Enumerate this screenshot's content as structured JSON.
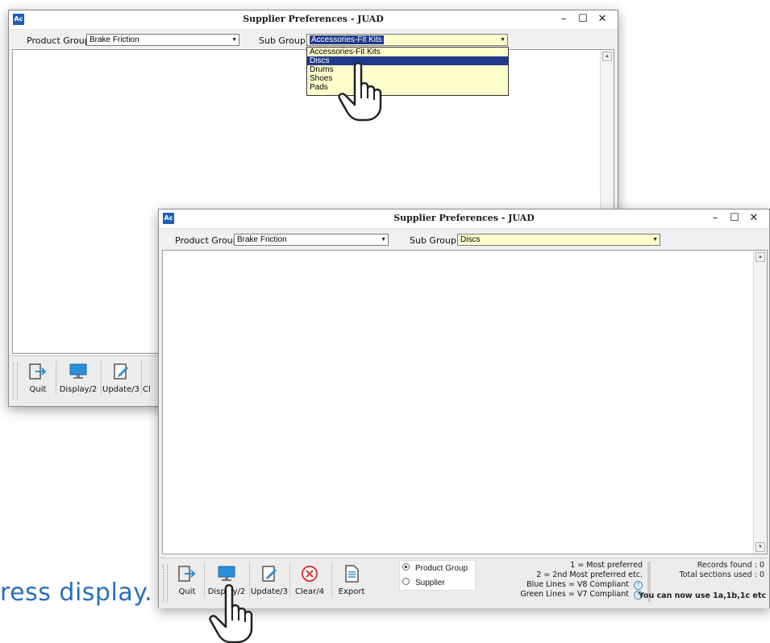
{
  "background_caption": "ress display.",
  "back_window": {
    "icon_label": "Ac",
    "title": "Supplier Preferences - JUAD",
    "product_group_label": "Product Group",
    "product_group_value": "Brake Friction",
    "sub_group_label": "Sub Group",
    "sub_group_value": "Accessories-Fit Kits",
    "dropdown_options": [
      "Accessories-Fit Kits",
      "Discs",
      "Drums",
      "Shoes",
      "Pads"
    ],
    "dropdown_selected": "Discs",
    "toolbar": {
      "quit": "Quit",
      "display": "Display/2",
      "update": "Update/3",
      "clear_partial": "Cl"
    }
  },
  "front_window": {
    "icon_label": "Ac",
    "title": "Supplier Preferences - JUAD",
    "product_group_label": "Product Group",
    "product_group_value": "Brake Friction",
    "sub_group_label": "Sub Group",
    "sub_group_value": "Discs",
    "toolbar": {
      "quit": "Quit",
      "display": "Display/2",
      "update": "Update/3",
      "clear": "Clear/4",
      "export": "Export"
    },
    "radio_options": [
      "Product Group",
      "Supplier"
    ],
    "radio_selected": "Product Group",
    "legend": {
      "line1": "1 = Most preferred",
      "line2": "2 = 2nd Most preferred etc.",
      "line3": "Blue Lines = V8 Compliant",
      "line4": "Green Lines = V7 Compliant"
    },
    "status": {
      "records_found": "Records found : 0",
      "sections_used": "Total sections used : 0",
      "hint": "You can now use 1a,1b,1c etc"
    }
  },
  "window_controls": {
    "minimize": "–",
    "maximize": "☐",
    "close": "✕"
  },
  "icons": [
    "app-icon",
    "quit-icon",
    "display-icon",
    "update-icon",
    "clear-icon",
    "export-icon",
    "hand-cursor-icon"
  ],
  "colors": {
    "selection": "#1f3a8c",
    "combo_highlight": "#ffffcc",
    "accent_blue": "#2a6fc0",
    "clear_red": "#d63a3a"
  }
}
